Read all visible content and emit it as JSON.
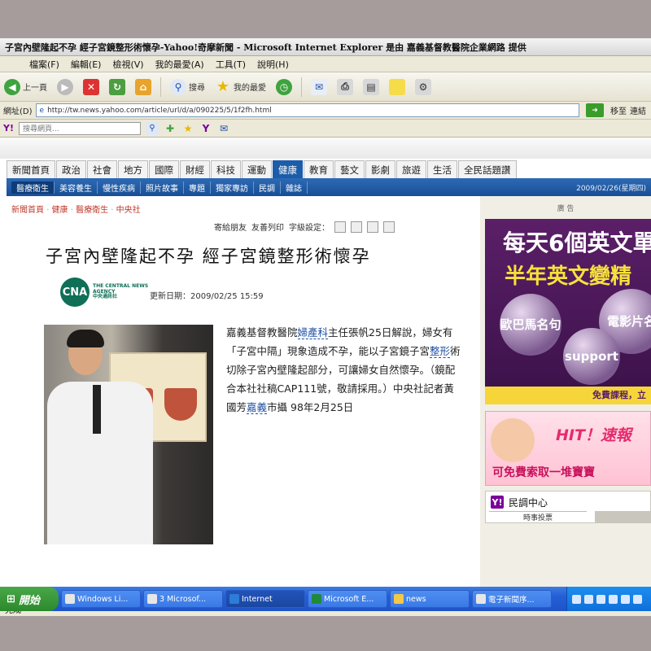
{
  "window": {
    "title": "子宮內壁隆起不孕 經子宮鏡整形術懷孕-Yahoo!奇摩新聞 - Microsoft Internet Explorer 是由 嘉義基督教醫院企業網路 提供"
  },
  "menu": [
    "檔案(F)",
    "編輯(E)",
    "檢視(V)",
    "我的最愛(A)",
    "工具(T)",
    "說明(H)"
  ],
  "toolbar": {
    "back_label": "上一頁",
    "search_label": "搜尋",
    "favorites_label": "我的最愛"
  },
  "address": {
    "label": "網址(D)",
    "url": "http://tw.news.yahoo.com/article/url/d/a/090225/5/1f2fh.html",
    "go_label": "移至",
    "links_label": "連結"
  },
  "yahoo_toolbar": {
    "search_placeholder": "搜尋網頁..."
  },
  "site": {
    "tabs": [
      "新聞首頁",
      "政治",
      "社會",
      "地方",
      "國際",
      "財經",
      "科技",
      "運動",
      "健康",
      "教育",
      "藝文",
      "影劇",
      "旅遊",
      "生活",
      "全民話題讚"
    ],
    "active_tab": "健康",
    "subtabs": [
      "醫療衛生",
      "美容養生",
      "慢性疾病",
      "照片故事",
      "專題",
      "獨家專訪",
      "民調",
      "雜誌"
    ],
    "date": "2009/02/26(星期四)",
    "breadcrumb": [
      "新聞首頁",
      "健康",
      "醫療衛生",
      "中央社"
    ],
    "tools": {
      "share": "寄給朋友",
      "print": "友善列印",
      "font": "字級設定："
    }
  },
  "article": {
    "headline": "子宮內壁隆起不孕 經子宮鏡整形術懷孕",
    "source_logo_text": "THE CENTRAL NEWS AGENCY",
    "source_logo_cn": "中央通訊社",
    "source_abbr": "CNA",
    "updated_label": "更新日期：",
    "updated": "2009/02/25 15:59",
    "body_1": "嘉義基督教醫院",
    "body_link_1": "婦產科",
    "body_2": "主任張帆25日解說，婦女有「子宮中隔」現象造成不孕，能以子宮鏡子宮",
    "body_link_2": "整形",
    "body_3": "術切除子宮內壁隆起部分，可讓婦女自然懷孕。（鏡配合本社社稿CAP111號，敬請採用。）中央社記者黃國芳",
    "body_link_3": "嘉義",
    "body_4": "市攝 98年2月25日"
  },
  "ads": {
    "label": "廣 告",
    "english": {
      "line1": "每天6個英文單",
      "line2": "半年英文變精",
      "bubble1": "歐巴馬名句",
      "bubble2": "電影片名",
      "bubble3": "support",
      "footer": "免費課程，立"
    },
    "baby": {
      "hit": "HIT！速報",
      "free": "可免費索取一堆寶寶"
    }
  },
  "poll": {
    "title": "民調中心",
    "tab": "時事投票"
  },
  "statusbar": {
    "text": "完成"
  },
  "taskbar": {
    "start": "開始",
    "items": [
      "Windows Li...",
      "3 Microsof...",
      "Internet",
      "Microsoft E...",
      "news",
      "電子新聞序..."
    ],
    "active_index": 2
  }
}
